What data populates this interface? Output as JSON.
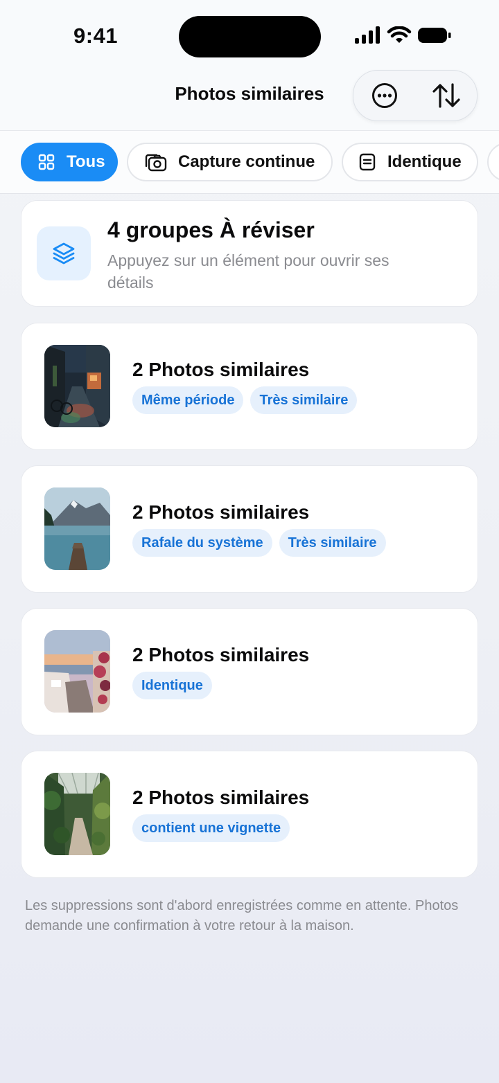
{
  "status_bar": {
    "time": "9:41"
  },
  "header": {
    "title": "Photos similaires",
    "more_icon": "ellipsis-circle-icon",
    "sort_icon": "sort-arrows-icon"
  },
  "filters": [
    {
      "label": "Tous",
      "icon": "grid-icon",
      "active": true
    },
    {
      "label": "Capture continue",
      "icon": "camera-burst-icon",
      "active": false
    },
    {
      "label": "Identique",
      "icon": "document-lines-icon",
      "active": false
    }
  ],
  "summary": {
    "icon": "stack-layers-icon",
    "title": "4 groupes À réviser",
    "subtitle": "Appuyez sur un élément pour ouvrir ses détails"
  },
  "groups": [
    {
      "title": "2 Photos similaires",
      "tags": [
        "Même période",
        "Très similaire"
      ],
      "thumbnail": "rainy-street-night"
    },
    {
      "title": "2 Photos similaires",
      "tags": [
        "Rafale du système",
        "Très similaire"
      ],
      "thumbnail": "mountain-lake-dock"
    },
    {
      "title": "2 Photos similaires",
      "tags": [
        "Identique"
      ],
      "thumbnail": "seaside-sunset-village"
    },
    {
      "title": "2 Photos similaires",
      "tags": [
        "contient une vignette"
      ],
      "thumbnail": "greenhouse-path"
    }
  ],
  "footer": "Les suppressions sont d'abord enregistrées comme en attente. Photos demande une confirmation à votre retour à la maison.",
  "colors": {
    "accent": "#1a8cf5",
    "tag_bg": "#e6f0fc",
    "tag_text": "#1873d6"
  }
}
